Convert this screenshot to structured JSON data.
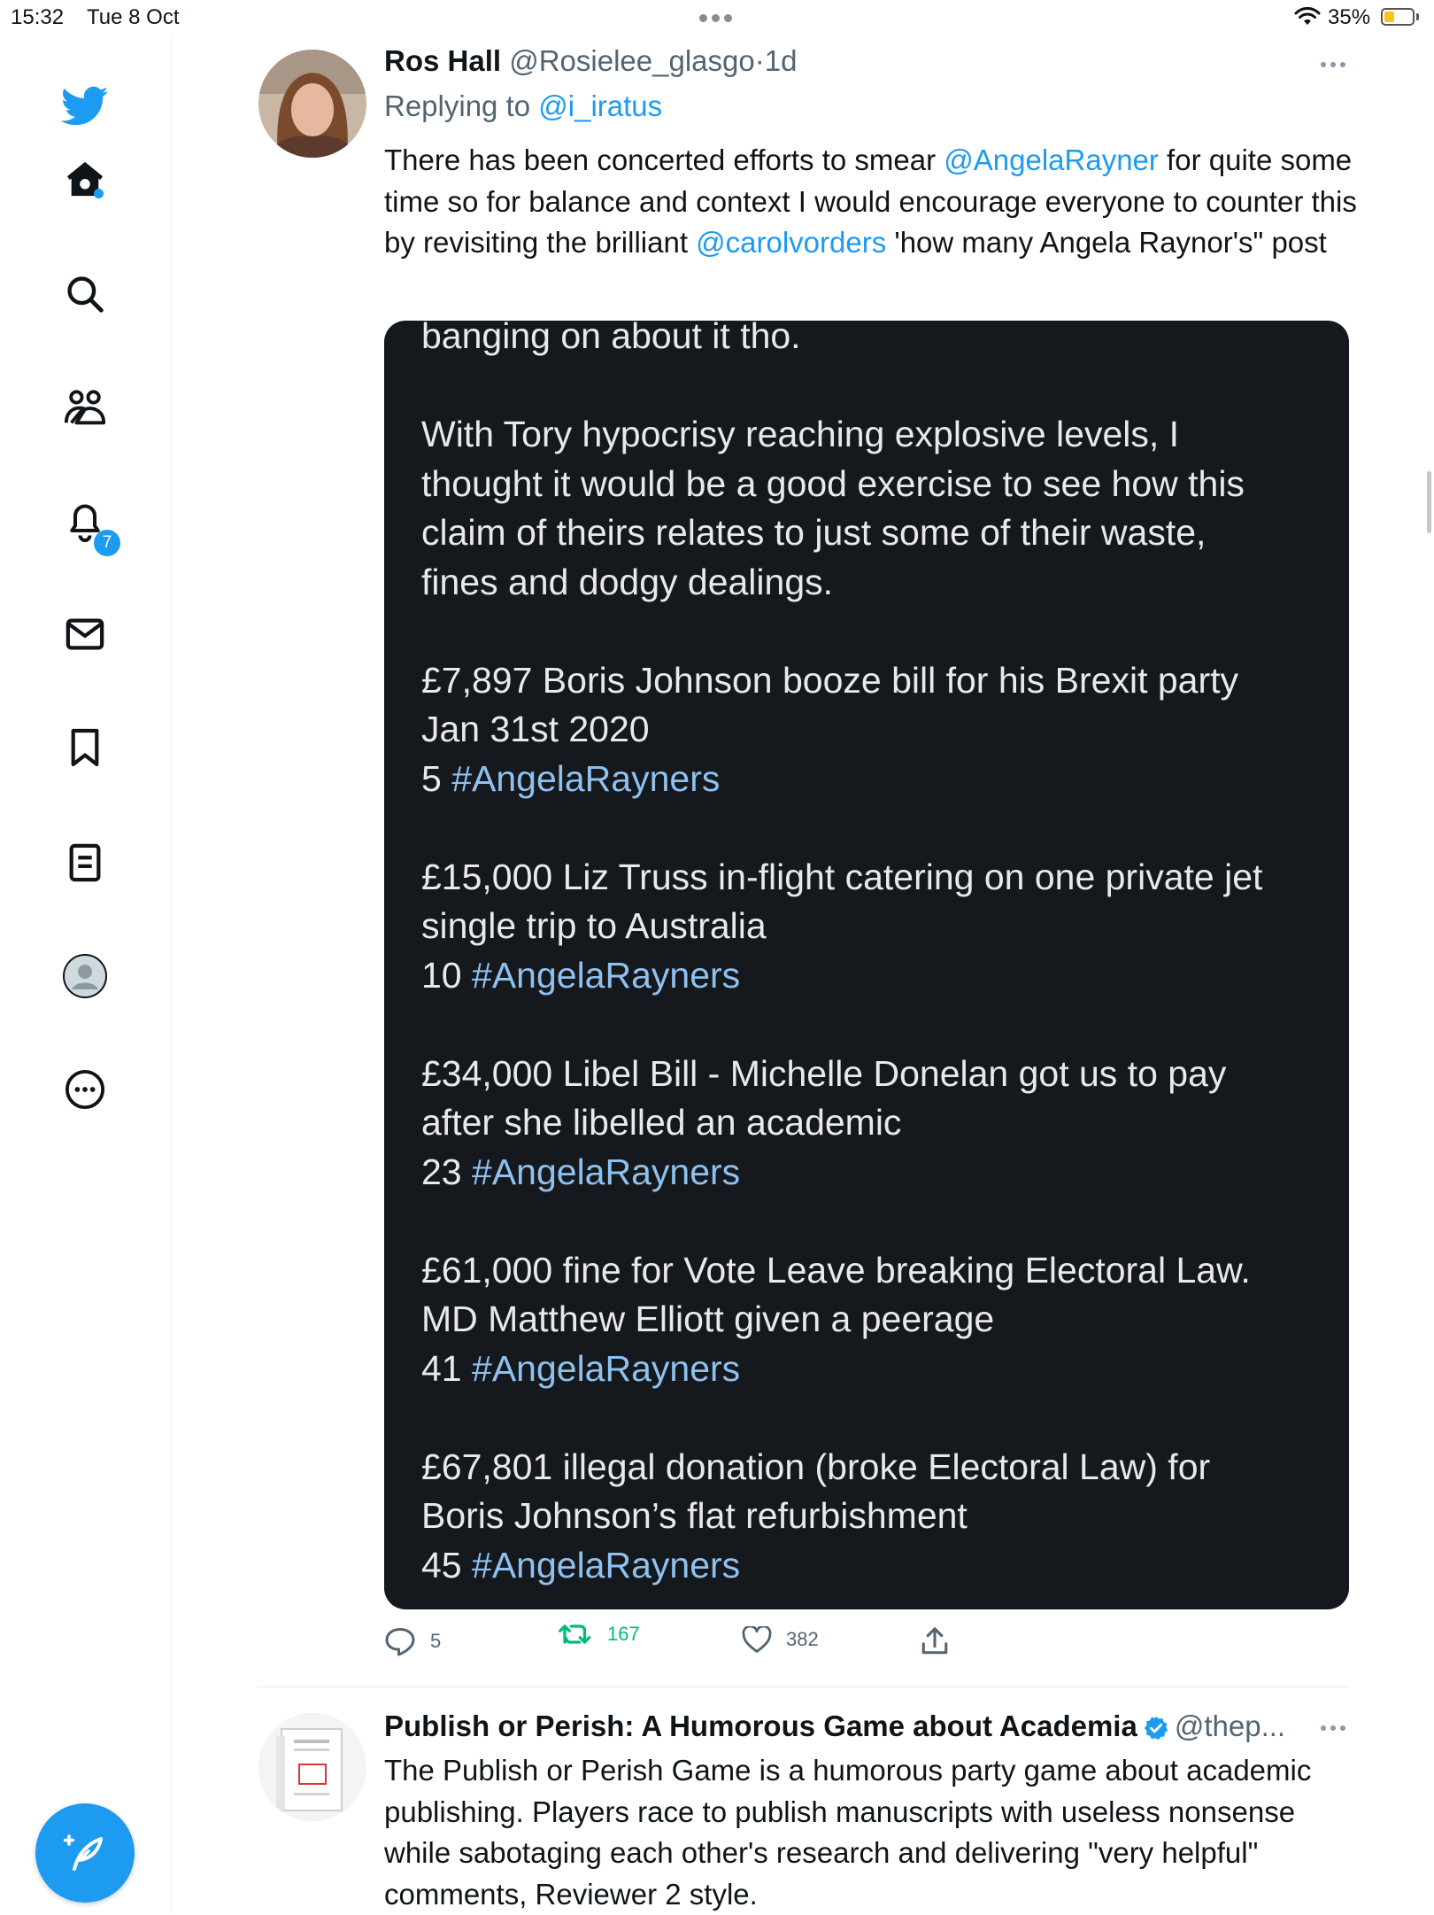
{
  "status_bar": {
    "time": "15:32",
    "date": "Tue 8 Oct",
    "battery": "35%",
    "battery_level": 0.35
  },
  "sidebar": {
    "items": [
      {
        "name": "twitter-logo"
      },
      {
        "name": "home"
      },
      {
        "name": "search"
      },
      {
        "name": "communities"
      },
      {
        "name": "notifications",
        "badge": "7"
      },
      {
        "name": "messages"
      },
      {
        "name": "bookmarks"
      },
      {
        "name": "lists"
      },
      {
        "name": "profile"
      },
      {
        "name": "more"
      }
    ],
    "accent": "#1d9bf0"
  },
  "tweet1": {
    "name": "Ros Hall",
    "handle": "@Rosielee_glasgo",
    "sep": "·",
    "time": "1d",
    "replying_label": "Replying to",
    "replying_to": "@i_iratus",
    "text_1": "There has been concerted efforts to smear ",
    "mention_1": "@AngelaRayner",
    "text_2": " for quite some time so for balance and context I would encourage everyone to counter this by revisiting the brilliant ",
    "mention_2": "@carolvorders",
    "text_3": "  'how many Angela Raynor's\" post",
    "media": {
      "line_0": "banging on about it tho.",
      "para_1": [
        "With Tory hypocrisy reaching explosive levels, I",
        "thought it would be a good exercise to see how this",
        "claim of theirs relates to just some of their waste,",
        "fines and dodgy dealings."
      ],
      "items": [
        {
          "l1": "£7,897 Boris Johnson booze bill for his Brexit party",
          "l2": "Jan 31st 2020",
          "num": "5",
          "tag": "#AngelaRayners"
        },
        {
          "l1": "£15,000 Liz Truss in-flight catering on one private jet",
          "l2": "single trip to Australia",
          "num": "10",
          "tag": "#AngelaRayners"
        },
        {
          "l1": "£34,000 Libel Bill - Michelle Donelan got us to pay",
          "l2": "after she libelled an academic",
          "num": "23",
          "tag": "#AngelaRayners"
        },
        {
          "l1": "£61,000 fine for Vote Leave breaking Electoral Law.",
          "l2": "MD Matthew Elliott given a peerage",
          "num": "41",
          "tag": "#AngelaRayners"
        },
        {
          "l1": "£67,801 illegal donation (broke Electoral Law) for",
          "l2": "Boris Johnson’s flat refurbishment",
          "num": "45",
          "tag": "#AngelaRayners"
        }
      ]
    },
    "replies": "5",
    "retweets": "167",
    "likes": "382"
  },
  "tweet2": {
    "name": "Publish or Perish: A Humorous Game about Academia",
    "handle": "@thep...",
    "text": "The Publish or Perish Game is a humorous party game about academic publishing. Players race to publish manuscripts with useless nonsense while sabotaging each other's research and delivering \"very helpful\" comments, Reviewer 2 style."
  }
}
